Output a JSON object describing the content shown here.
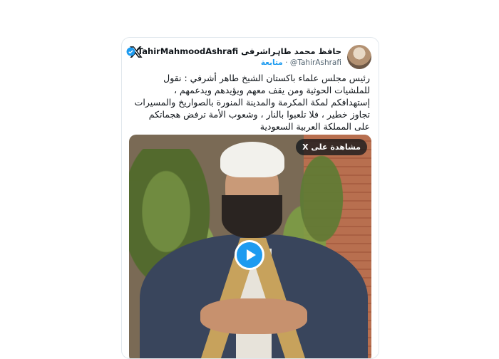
{
  "tweet": {
    "display_name": "TahirMahmoodAshrafi حافظ محمد طاہراشرفی",
    "handle": "@TahirAshrafi",
    "separator": "·",
    "follow_label": "متابعة",
    "text_lines": [
      "رئيس مجلس علماء باكستان الشيخ طاهر أشرفي  : نقول",
      "للملشيات الحوثية ومن يقف معهم ويؤيدهم ويدعمهم ،",
      "إستهدافكم لمكة المكرمة والمدينة المنورة بالصواريخ والمسيرات",
      "تجاوز خطير ، فلا تلعبوا بالنار ، وشعوب الأمة ترفض هجماتكم",
      "على المملكة العربية السعودية"
    ]
  },
  "media": {
    "watch_label": "مشاهدة على X",
    "play_icon": "play-icon"
  },
  "colors": {
    "accent": "#1d9bf0",
    "text": "#0f1419",
    "muted": "#536471"
  }
}
